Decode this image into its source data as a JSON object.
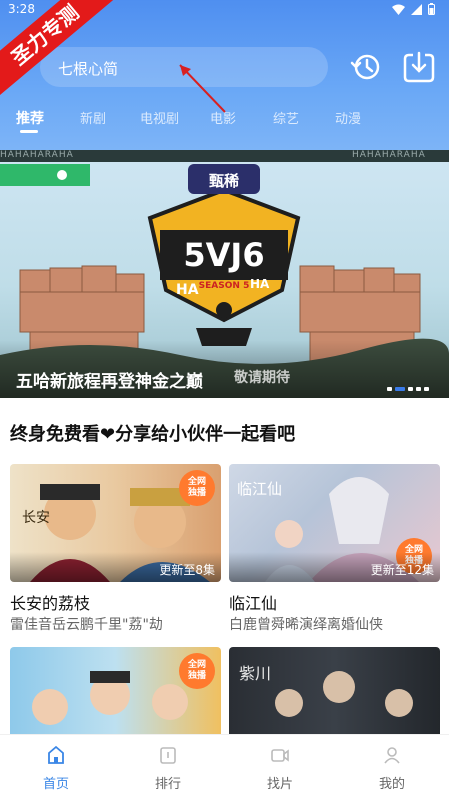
{
  "status": {
    "time": "3:28"
  },
  "watermark": {
    "text": "圣力专测"
  },
  "search": {
    "placeholder": "七根心简"
  },
  "tabs": [
    {
      "label": "推荐",
      "active": true
    },
    {
      "label": "新剧"
    },
    {
      "label": "电视剧"
    },
    {
      "label": "电影"
    },
    {
      "label": "综艺"
    },
    {
      "label": "动漫"
    }
  ],
  "banner": {
    "title": "五哈新旅程再登神金之巅",
    "subtitle": "敬请期待",
    "strip_text": "HAHAHARAHA",
    "show_logo_text": "5V6 SEASON 5",
    "brand": "甄稀",
    "page_count": 5,
    "active_index": 1
  },
  "section": {
    "title": "终身免费看❤分享给小伙伴一起看吧",
    "heart_color": "#e2457a"
  },
  "cards": [
    {
      "title": "长安的荔枝",
      "desc": "雷佳音岳云鹏千里\"荔\"劫",
      "update": "更新至8集",
      "badge": "全网\n独播"
    },
    {
      "title": "临江仙",
      "desc": "白鹿曾舜晞演绎离婚仙侠",
      "update": "更新至12集",
      "badge": "全网\n独播"
    },
    {
      "title": "",
      "desc": "",
      "update": "",
      "badge": "全网\n独播"
    },
    {
      "title": "",
      "desc": "",
      "update": "",
      "badge": ""
    }
  ],
  "nav": [
    {
      "label": "首页",
      "icon": "home-icon",
      "active": true
    },
    {
      "label": "排行",
      "icon": "ranking-icon"
    },
    {
      "label": "找片",
      "icon": "video-camera-icon"
    },
    {
      "label": "我的",
      "icon": "user-icon"
    }
  ],
  "colors": {
    "accent": "#3a86e6",
    "header_top": "#4f8ff0",
    "watermark_red": "#e31a1a"
  }
}
